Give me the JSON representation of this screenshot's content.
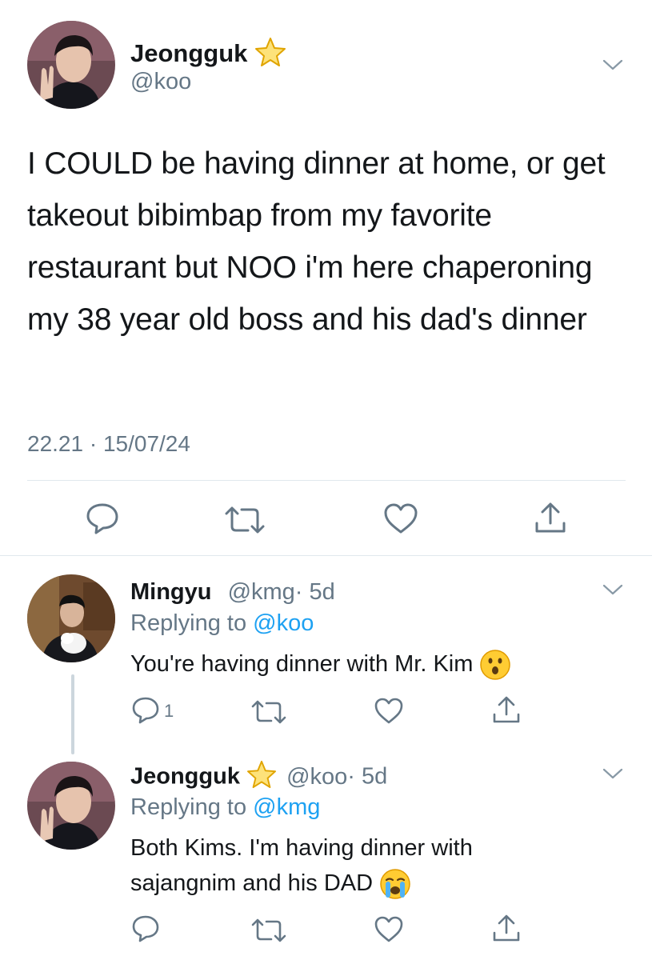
{
  "main_tweet": {
    "author_name": "Jeongguk",
    "author_handle": "@koo",
    "verified_icon": "star-icon",
    "text": "I COULD be having dinner at home, or get takeout bibimbap from my favorite restaurant but NOO i'm here chaperoning my 38 year old boss and his dad's dinner",
    "timestamp": "22.21 · 15/07/24",
    "actions": [
      "reply-icon",
      "retweet-icon",
      "like-icon",
      "share-icon"
    ]
  },
  "replies": [
    {
      "author_name": "Mingyu",
      "author_handle": "@kmg",
      "time": "· 5d",
      "replying_label": "Replying to",
      "replying_to": "@koo",
      "text": "You're having dinner with Mr. Kim",
      "emoji": "surprised-face-emoji",
      "reply_count": "1"
    },
    {
      "author_name": "Jeongguk",
      "author_handle": "@koo",
      "time": "· 5d",
      "replying_label": "Replying to",
      "replying_to": "@kmg",
      "text_line1": "Both Kims. I'm having dinner with",
      "text_line2": "sajangnim and his DAD",
      "emoji": "crying-face-emoji"
    }
  ],
  "colors": {
    "accent": "#1da1f2",
    "muted": "#657786",
    "divider": "#e1e8ed",
    "star": "#f5c518"
  }
}
